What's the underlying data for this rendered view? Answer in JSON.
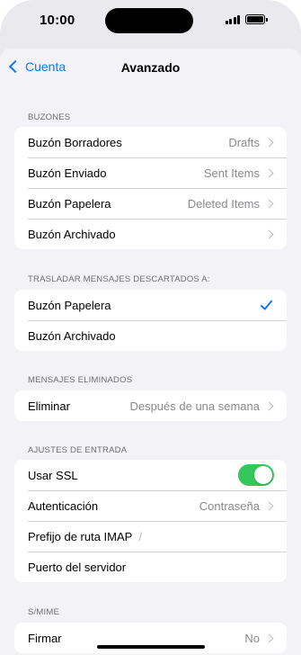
{
  "status_bar": {
    "time": "10:00"
  },
  "nav": {
    "back_label": "Cuenta",
    "title": "Avanzado"
  },
  "sections": {
    "buzones": {
      "header": "BUZONES",
      "rows": [
        {
          "label": "Buzón Borradores",
          "value": "Drafts"
        },
        {
          "label": "Buzón Enviado",
          "value": "Sent Items"
        },
        {
          "label": "Buzón Papelera",
          "value": "Deleted Items"
        },
        {
          "label": "Buzón Archivado",
          "value": ""
        }
      ]
    },
    "trasladar": {
      "header": "TRASLADAR MENSAJES DESCARTADOS A:",
      "rows": [
        {
          "label": "Buzón Papelera",
          "selected": true
        },
        {
          "label": "Buzón Archivado",
          "selected": false
        }
      ]
    },
    "eliminados": {
      "header": "MENSAJES ELIMINADOS",
      "rows": [
        {
          "label": "Eliminar",
          "value": "Después de una semana"
        }
      ]
    },
    "entrada": {
      "header": "AJUSTES DE ENTRADA",
      "rows": [
        {
          "label": "Usar SSL",
          "toggle_on": true
        },
        {
          "label": "Autenticación",
          "value": "Contraseña"
        },
        {
          "label": "Prefijo de ruta IMAP",
          "value": "/"
        },
        {
          "label": "Puerto del servidor",
          "value": ""
        }
      ]
    },
    "smime": {
      "header": "S/MIME",
      "rows": [
        {
          "label": "Firmar",
          "value": "No"
        }
      ]
    }
  },
  "colors": {
    "accent": "#0a7aff",
    "toggle_on": "#34c759",
    "background": "#f2f2f7"
  }
}
